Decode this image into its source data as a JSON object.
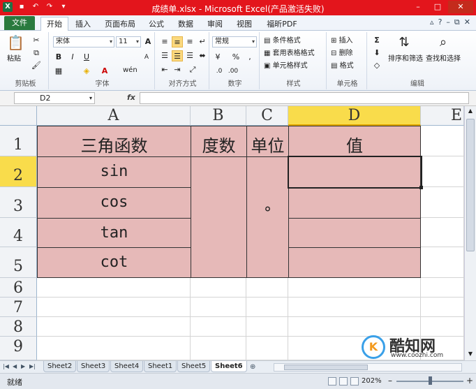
{
  "window": {
    "title": "成绩单.xlsx - Microsoft Excel(产品激活失败)",
    "minimize": "–",
    "maximize": "□",
    "close": "✕"
  },
  "ribbon_tabs": [
    "文件",
    "开始",
    "插入",
    "页面布局",
    "公式",
    "数据",
    "审阅",
    "视图",
    "福昕PDF"
  ],
  "ribbon_tab_active": "开始",
  "ribbon": {
    "clipboard": {
      "label": "剪贴板",
      "paste": "粘贴",
      "cut": "✂",
      "copy": "⧉",
      "format_painter": "🖌"
    },
    "font": {
      "label": "字体",
      "font_name": "宋体",
      "font_size": "11",
      "bold": "B",
      "italic": "I",
      "underline": "U",
      "grow": "A",
      "shrink": "A",
      "wen": "wén"
    },
    "alignment": {
      "label": "对齐方式"
    },
    "number": {
      "label": "数字",
      "format": "常规",
      "percent": "%",
      "comma": ","
    },
    "styles": {
      "label": "样式",
      "conditional": "条件格式",
      "table": "套用表格格式",
      "cell_styles": "单元格样式"
    },
    "cells": {
      "label": "单元格",
      "insert": "插入",
      "delete": "删除",
      "format": "格式"
    },
    "editing": {
      "label": "编辑",
      "sigma": "Σ",
      "sort": "排序和筛选",
      "find": "查找和选择"
    }
  },
  "formula_bar": {
    "name_box": "D2",
    "fx": "fx",
    "value": ""
  },
  "columns": [
    {
      "label": "A",
      "active": false
    },
    {
      "label": "B",
      "active": false
    },
    {
      "label": "C",
      "active": false
    },
    {
      "label": "D",
      "active": true
    },
    {
      "label": "E",
      "active": false
    }
  ],
  "rows": [
    "1",
    "2",
    "3",
    "4",
    "5",
    "6",
    "7",
    "8",
    "9"
  ],
  "active_row": "2",
  "table": {
    "header": {
      "a": "三角函数",
      "b": "度数",
      "c": "单位",
      "d": "值"
    },
    "functions": [
      "sin",
      "cos",
      "tan",
      "cot"
    ],
    "unit": "°"
  },
  "sheet_tabs": [
    "Sheet2",
    "Sheet3",
    "Sheet4",
    "Sheet1",
    "Sheet5",
    "Sheet6"
  ],
  "active_sheet": "Sheet6",
  "status": {
    "ready": "就绪",
    "zoom": "202%"
  },
  "watermark": {
    "name": "酷知网",
    "url": "www.coozhi.com",
    "logo": "K"
  },
  "colors": {
    "accent": "#e3151c",
    "file_tab": "#2a7a3e",
    "table_fill": "#e6b9b8",
    "active_header": "#f9dc4b"
  }
}
